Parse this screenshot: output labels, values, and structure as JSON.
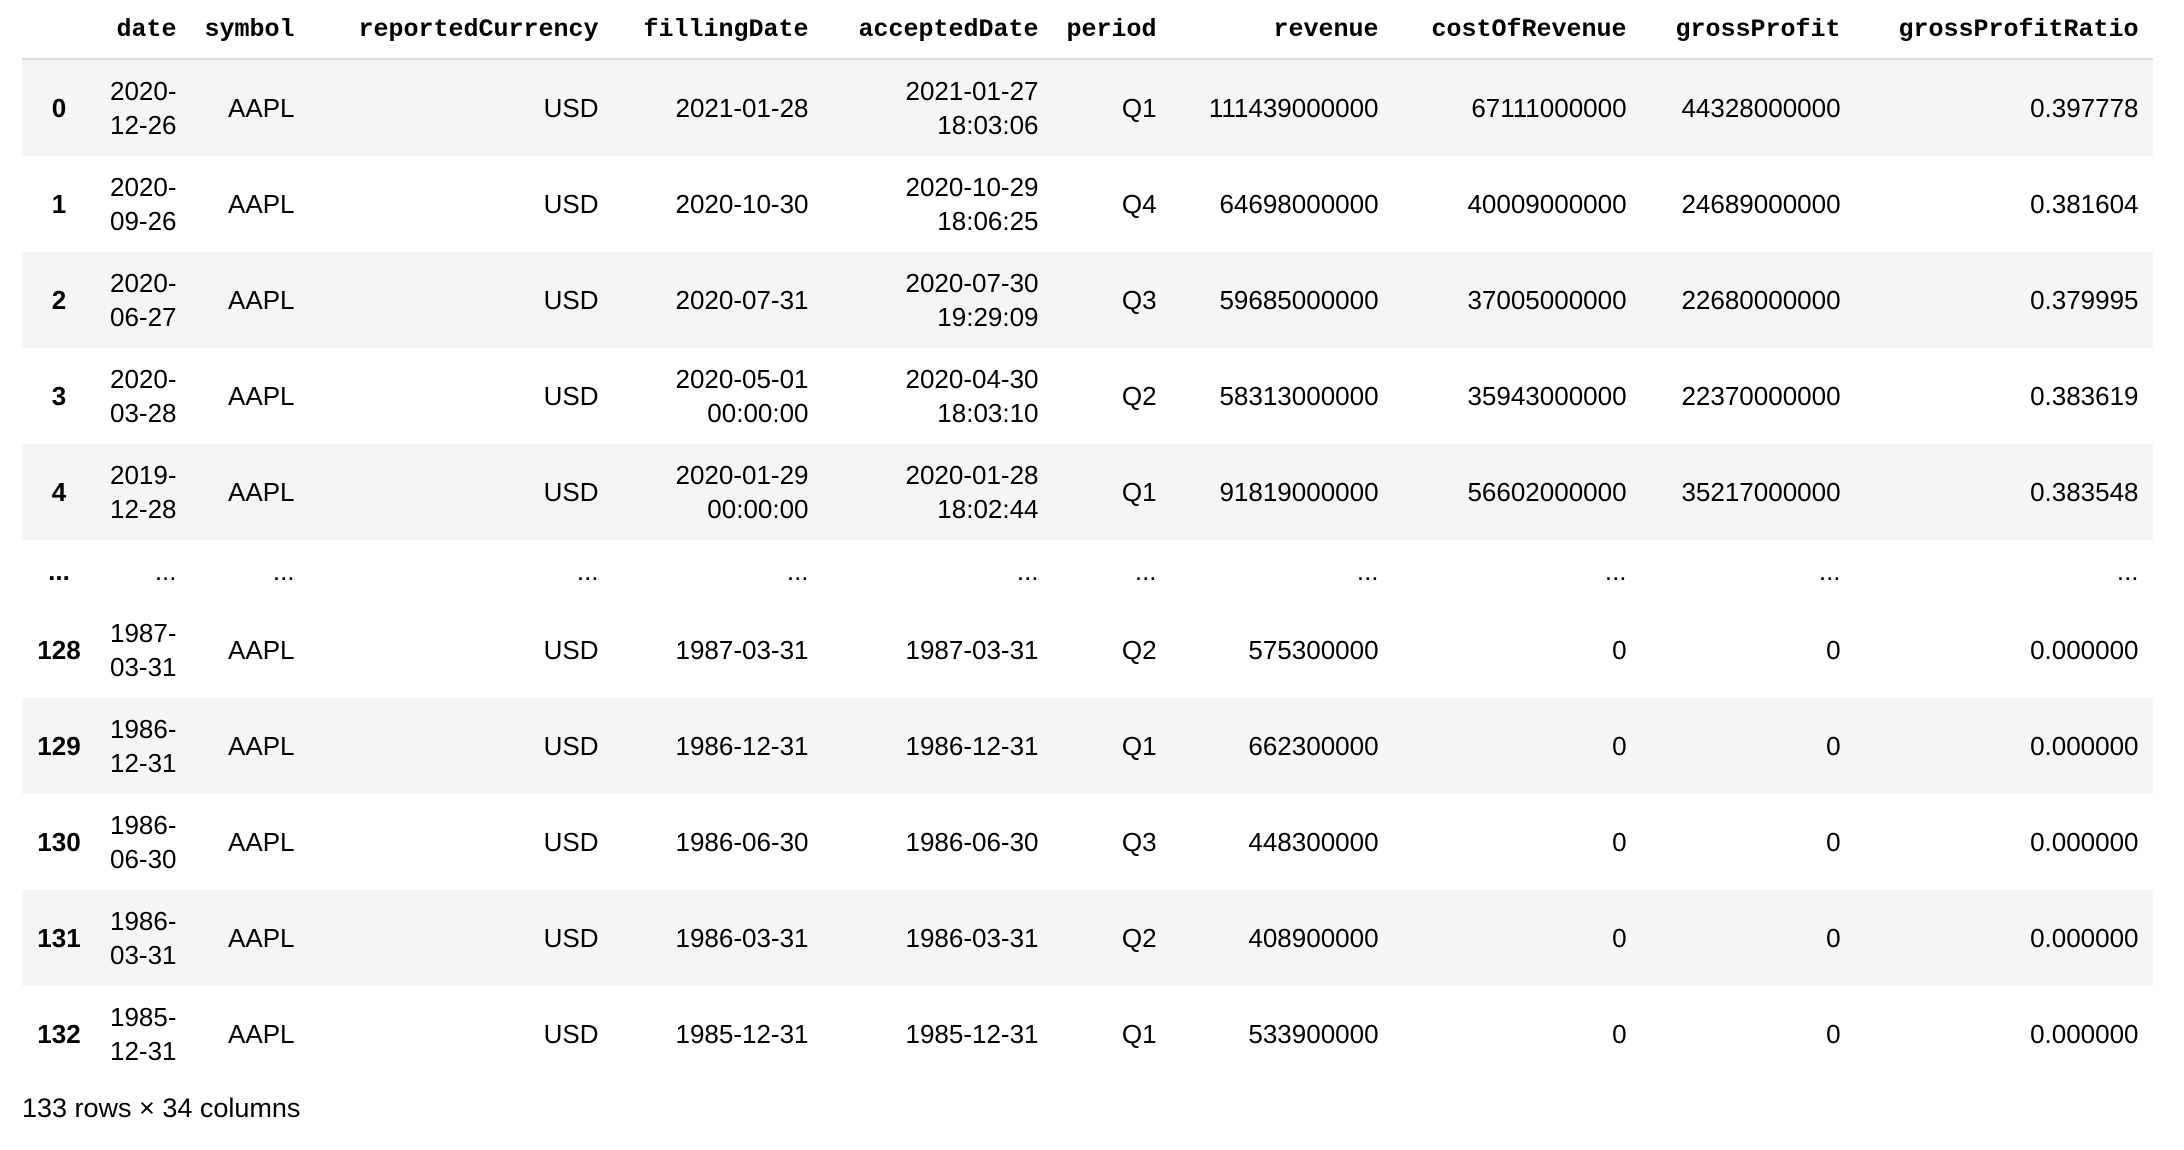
{
  "table": {
    "headers": [
      "",
      "date",
      "symbol",
      "reportedCurrency",
      "fillingDate",
      "acceptedDate",
      "period",
      "revenue",
      "costOfRevenue",
      "grossProfit",
      "grossProfitRatio"
    ],
    "rows": [
      {
        "index": "0",
        "date": "2020-12-26",
        "symbol": "AAPL",
        "reportedCurrency": "USD",
        "fillingDate": "2021-01-28",
        "acceptedDate": "2021-01-27 18:03:06",
        "period": "Q1",
        "revenue": "111439000000",
        "costOfRevenue": "67111000000",
        "grossProfit": "44328000000",
        "grossProfitRatio": "0.397778"
      },
      {
        "index": "1",
        "date": "2020-09-26",
        "symbol": "AAPL",
        "reportedCurrency": "USD",
        "fillingDate": "2020-10-30",
        "acceptedDate": "2020-10-29 18:06:25",
        "period": "Q4",
        "revenue": "64698000000",
        "costOfRevenue": "40009000000",
        "grossProfit": "24689000000",
        "grossProfitRatio": "0.381604"
      },
      {
        "index": "2",
        "date": "2020-06-27",
        "symbol": "AAPL",
        "reportedCurrency": "USD",
        "fillingDate": "2020-07-31",
        "acceptedDate": "2020-07-30 19:29:09",
        "period": "Q3",
        "revenue": "59685000000",
        "costOfRevenue": "37005000000",
        "grossProfit": "22680000000",
        "grossProfitRatio": "0.379995"
      },
      {
        "index": "3",
        "date": "2020-03-28",
        "symbol": "AAPL",
        "reportedCurrency": "USD",
        "fillingDate": "2020-05-01 00:00:00",
        "acceptedDate": "2020-04-30 18:03:10",
        "period": "Q2",
        "revenue": "58313000000",
        "costOfRevenue": "35943000000",
        "grossProfit": "22370000000",
        "grossProfitRatio": "0.383619"
      },
      {
        "index": "4",
        "date": "2019-12-28",
        "symbol": "AAPL",
        "reportedCurrency": "USD",
        "fillingDate": "2020-01-29 00:00:00",
        "acceptedDate": "2020-01-28 18:02:44",
        "period": "Q1",
        "revenue": "91819000000",
        "costOfRevenue": "56602000000",
        "grossProfit": "35217000000",
        "grossProfitRatio": "0.383548"
      },
      {
        "index": "...",
        "date": "...",
        "symbol": "...",
        "reportedCurrency": "...",
        "fillingDate": "...",
        "acceptedDate": "...",
        "period": "...",
        "revenue": "...",
        "costOfRevenue": "...",
        "grossProfit": "...",
        "grossProfitRatio": "..."
      },
      {
        "index": "128",
        "date": "1987-03-31",
        "symbol": "AAPL",
        "reportedCurrency": "USD",
        "fillingDate": "1987-03-31",
        "acceptedDate": "1987-03-31",
        "period": "Q2",
        "revenue": "575300000",
        "costOfRevenue": "0",
        "grossProfit": "0",
        "grossProfitRatio": "0.000000"
      },
      {
        "index": "129",
        "date": "1986-12-31",
        "symbol": "AAPL",
        "reportedCurrency": "USD",
        "fillingDate": "1986-12-31",
        "acceptedDate": "1986-12-31",
        "period": "Q1",
        "revenue": "662300000",
        "costOfRevenue": "0",
        "grossProfit": "0",
        "grossProfitRatio": "0.000000"
      },
      {
        "index": "130",
        "date": "1986-06-30",
        "symbol": "AAPL",
        "reportedCurrency": "USD",
        "fillingDate": "1986-06-30",
        "acceptedDate": "1986-06-30",
        "period": "Q3",
        "revenue": "448300000",
        "costOfRevenue": "0",
        "grossProfit": "0",
        "grossProfitRatio": "0.000000"
      },
      {
        "index": "131",
        "date": "1986-03-31",
        "symbol": "AAPL",
        "reportedCurrency": "USD",
        "fillingDate": "1986-03-31",
        "acceptedDate": "1986-03-31",
        "period": "Q2",
        "revenue": "408900000",
        "costOfRevenue": "0",
        "grossProfit": "0",
        "grossProfitRatio": "0.000000"
      },
      {
        "index": "132",
        "date": "1985-12-31",
        "symbol": "AAPL",
        "reportedCurrency": "USD",
        "fillingDate": "1985-12-31",
        "acceptedDate": "1985-12-31",
        "period": "Q1",
        "revenue": "533900000",
        "costOfRevenue": "0",
        "grossProfit": "0",
        "grossProfitRatio": "0.000000"
      }
    ]
  },
  "footer": {
    "summary": "133 rows × 34 columns"
  }
}
